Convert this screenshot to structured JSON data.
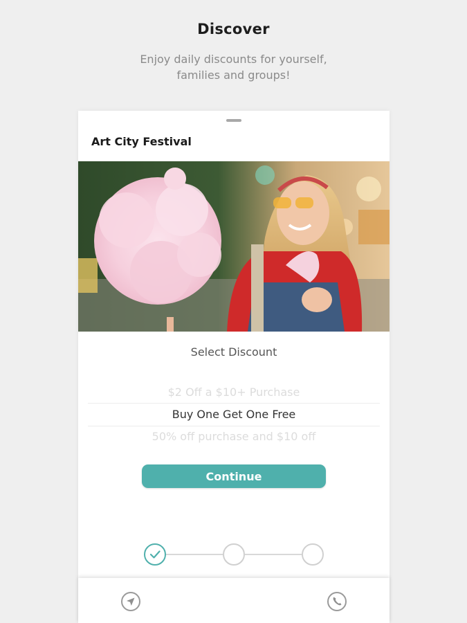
{
  "header": {
    "title": "Discover",
    "subtitle": "Enjoy daily discounts for yourself, families and groups!"
  },
  "card": {
    "event_title": "Art City Festival",
    "hero_image": "woman-with-cotton-candy-at-fair-photo",
    "select_heading": "Select Discount",
    "discount_options": [
      {
        "label": "$2 Off a $10+ Purchase",
        "selected": false
      },
      {
        "label": "Buy One Get One Free",
        "selected": true
      },
      {
        "label": "50% off purchase and $10 off",
        "selected": false
      }
    ],
    "continue_label": "Continue",
    "steps": [
      {
        "state": "completed",
        "icon": "check-icon"
      },
      {
        "state": "pending"
      },
      {
        "state": "pending"
      }
    ]
  },
  "bottom_bar": {
    "icons": [
      "location-arrow-icon",
      "phone-icon"
    ]
  },
  "colors": {
    "accent": "#4fb0ac",
    "background": "#efefef",
    "card": "#ffffff"
  }
}
